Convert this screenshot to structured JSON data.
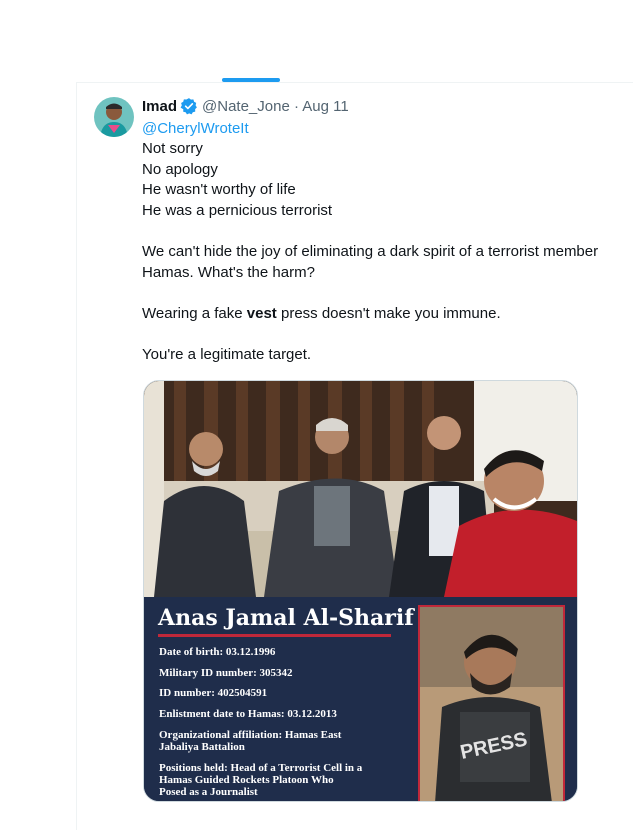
{
  "tweet": {
    "author_name": "Imad",
    "handle_and_date": "@Nate_Jone · Aug 11",
    "reply_to": "@CherylWroteIt",
    "line1": "Not sorry",
    "line2": "No apology",
    "line3": "He wasn't worthy of life",
    "line4": "He was a pernicious terrorist",
    "para2": "We can't hide the joy of eliminating a dark spirit of a terrorist member Hamas. What's the harm?",
    "para3_before": "Wearing a fake ",
    "para3_bold": "vest",
    "para3_after": " press doesn't make you immune.",
    "para4": "You're a legitimate target."
  },
  "card": {
    "name": "Anas Jamal Al-Sharif",
    "dob": "Date of birth: 03.12.1996",
    "military_id": "Military ID number: 305342",
    "id_number": "ID number: 402504591",
    "enlistment": "Enlistment date to Hamas: 03.12.2013",
    "affiliation": "Organizational affiliation: Hamas East\nJabaliya Battalion",
    "positions": "Positions held: Head of a Terrorist Cell in a\nHamas Guided Rockets Platoon Who\nPosed as a Journalist",
    "vest_text": "PRESS"
  },
  "colors": {
    "accent": "#1d9bf0",
    "card_bg": "#1f2d4b",
    "card_accent": "#c0283a"
  }
}
